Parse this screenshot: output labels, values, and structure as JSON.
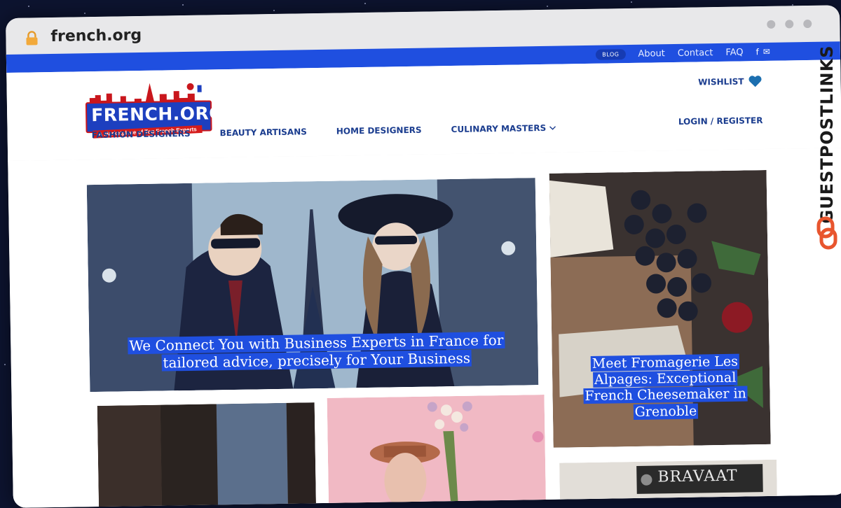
{
  "browser": {
    "domain": "french.org"
  },
  "topbar": {
    "blog": "BLOG",
    "links": [
      "About",
      "Contact",
      "FAQ"
    ]
  },
  "header": {
    "logo_text": "FRENCH.ORG",
    "logo_tagline": "A Marketplace of Top French Experts",
    "wishlist": "WISHLIST",
    "login": "LOGIN / REGISTER",
    "nav": [
      "FASHION DESIGNERS",
      "BEAUTY ARTISANS",
      "HOME DESIGNERS",
      "CULINARY MASTERS"
    ]
  },
  "cards": {
    "hero_caption": "We Connect You with Business Experts in France for tailored advice, precisely for Your Business",
    "cheese_caption": "Meet Fromagerie Les Alpages: Exceptional French Cheesemaker in Grenoble",
    "shop_sign": "BRAVAAT"
  },
  "watermark": {
    "text": "GUESTPOSTLINKS"
  },
  "colors": {
    "brand_blue": "#1f4fe0",
    "nav_text": "#1b3d8f",
    "logo_red": "#c9161c",
    "lock": "#f2a93b",
    "watermark_icon": "#e8552e"
  }
}
